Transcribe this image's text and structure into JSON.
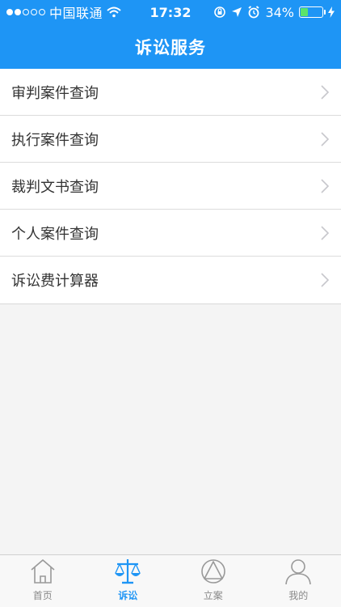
{
  "status_bar": {
    "carrier": "中国联通",
    "time": "17:32",
    "battery": "34%",
    "battery_level": 0.34,
    "signal_bars_on": 2,
    "signal_bars_total": 5
  },
  "header": {
    "title": "诉讼服务",
    "bg_color": "#1e95f5"
  },
  "menu": {
    "items": [
      {
        "label": "审判案件查询",
        "icon": "chevron-right-icon"
      },
      {
        "label": "执行案件查询",
        "icon": "chevron-right-icon"
      },
      {
        "label": "裁判文书查询",
        "icon": "chevron-right-icon"
      },
      {
        "label": "个人案件查询",
        "icon": "chevron-right-icon"
      },
      {
        "label": "诉讼费计算器",
        "icon": "chevron-right-icon"
      }
    ]
  },
  "tabbar": {
    "active_color": "#1e95f5",
    "tabs": [
      {
        "label": "首页",
        "icon": "home-icon",
        "active": false
      },
      {
        "label": "诉讼",
        "icon": "scales-icon",
        "active": true
      },
      {
        "label": "立案",
        "icon": "triangle-circle-icon",
        "active": false
      },
      {
        "label": "我的",
        "icon": "user-icon",
        "active": false
      }
    ]
  }
}
